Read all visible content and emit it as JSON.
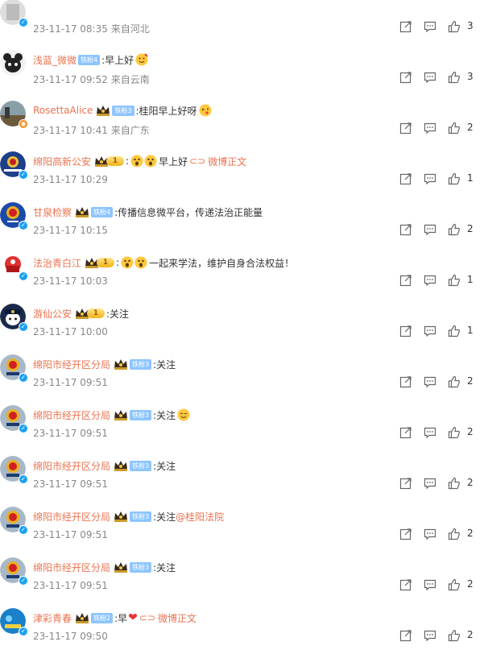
{
  "comments": [
    {
      "name": "",
      "level": "",
      "text": "",
      "time": "23-11-17 08:35",
      "location": "来自河北",
      "likes": "3",
      "avatar": "a0",
      "badge": "v"
    },
    {
      "name": "浅蓝_微微",
      "level": "铁粉4",
      "text": ":早上好",
      "time": "23-11-17 09:52",
      "location": "来自云南",
      "likes": "3",
      "avatar": "panda",
      "badge": "",
      "emoji": "party-icon"
    },
    {
      "name": "RosettaAlice",
      "level": "铁粉3",
      "text": ":桂阳早上好呀",
      "time": "23-11-17 10:41",
      "location": "来自广东",
      "likes": "2",
      "avatar": "photo",
      "badge": "o",
      "crown": true,
      "emoji": "kiss-icon"
    },
    {
      "name": "绵阳高新公安",
      "level": "1",
      "text": ":",
      "text2": "早上好",
      "link": "微博正文",
      "time": "23-11-17 10:29",
      "location": "",
      "likes": "1",
      "avatar": "police",
      "badge": "v",
      "crown": true,
      "gold": true
    },
    {
      "name": "甘泉检察",
      "level": "铁粉4",
      "text": ":传播信息微平台，传递法治正能量",
      "time": "23-11-17 10:15",
      "location": "",
      "likes": "2",
      "avatar": "emblem",
      "badge": "v",
      "crown": true
    },
    {
      "name": "法治青白江",
      "level": "1",
      "text": ":",
      "text2": "一起来学法，维护自身合法权益！",
      "time": "23-11-17 10:03",
      "location": "",
      "likes": "1",
      "avatar": "red",
      "badge": "v",
      "crown": true,
      "gold": true
    },
    {
      "name": "游仙公安",
      "level": "1",
      "text": ":关注",
      "time": "23-11-17 10:00",
      "location": "",
      "likes": "1",
      "avatar": "cop",
      "badge": "v",
      "crown": true,
      "gold": true
    },
    {
      "name": "绵阳市经开区分局",
      "level": "铁粉3",
      "text": ":关注",
      "time": "23-11-17 09:51",
      "location": "",
      "likes": "2",
      "avatar": "emblem2",
      "badge": "v",
      "crown": true
    },
    {
      "name": "绵阳市经开区分局",
      "level": "铁粉3",
      "text": ":关注",
      "time": "23-11-17 09:51",
      "location": "",
      "likes": "2",
      "avatar": "emblem2",
      "badge": "v",
      "crown": true,
      "emoji": "smile-icon"
    },
    {
      "name": "绵阳市经开区分局",
      "level": "铁粉3",
      "text": ":关注",
      "time": "23-11-17 09:51",
      "location": "",
      "likes": "2",
      "avatar": "emblem2",
      "badge": "v",
      "crown": true
    },
    {
      "name": "绵阳市经开区分局",
      "level": "铁粉3",
      "text": ":关注",
      "mention": "@桂阳法院",
      "time": "23-11-17 09:51",
      "location": "",
      "likes": "2",
      "avatar": "emblem2",
      "badge": "v",
      "crown": true
    },
    {
      "name": "绵阳市经开区分局",
      "level": "铁粉3",
      "text": ":关注",
      "time": "23-11-17 09:51",
      "location": "",
      "likes": "2",
      "avatar": "emblem2",
      "badge": "v",
      "crown": true
    },
    {
      "name": "津彩青春",
      "level": "铁粉2",
      "text": ":早",
      "link": "微博正文",
      "time": "23-11-17 09:50",
      "location": "",
      "likes": "2",
      "avatar": "blue",
      "badge": "v",
      "crown": true,
      "heart": true
    }
  ],
  "colors": {
    "accent": "#eb7350",
    "muted": "#888888",
    "v_badge": "#1aa1f5",
    "o_badge": "#f58a1a"
  }
}
